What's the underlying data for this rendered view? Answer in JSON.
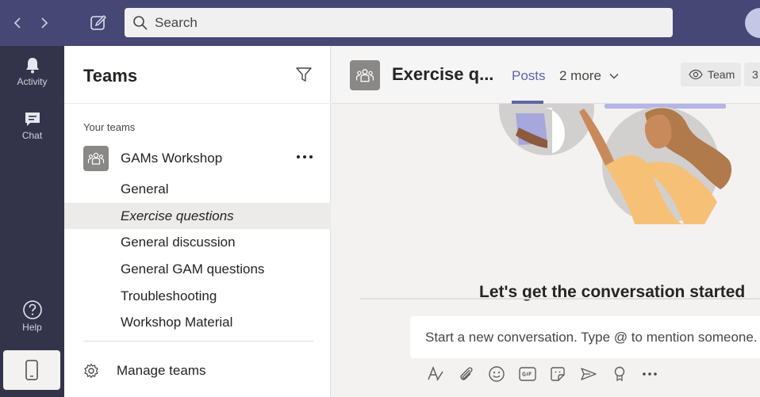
{
  "titlebar": {
    "back_icon": "chevron-left-icon",
    "forward_icon": "chevron-right-icon",
    "compose_icon": "compose-icon",
    "search_placeholder": "Search",
    "search_icon": "search-icon"
  },
  "rail": {
    "items": [
      {
        "label": "Activity",
        "icon": "bell-icon"
      },
      {
        "label": "Chat",
        "icon": "chat-icon"
      },
      {
        "label": "Help",
        "icon": "help-icon"
      }
    ],
    "mobile_icon": "mobile-phone-icon"
  },
  "teams_panel": {
    "title": "Teams",
    "filter_icon": "filter-icon",
    "section_label": "Your teams",
    "team": {
      "name": "GAMs Workshop",
      "more_icon": "more-icon",
      "channels": [
        {
          "name": "General",
          "active": false
        },
        {
          "name": "Exercise questions",
          "active": true
        },
        {
          "name": "General discussion",
          "active": false
        },
        {
          "name": "General GAM questions",
          "active": false
        },
        {
          "name": "Troubleshooting",
          "active": false
        },
        {
          "name": "Workshop Material",
          "active": false
        }
      ]
    },
    "manage_label": "Manage teams",
    "manage_icon": "gear-icon"
  },
  "channel_header": {
    "title": "Exercise q...",
    "tabs": [
      {
        "label": "Posts",
        "active": true
      },
      {
        "label": "2 more",
        "active": false
      }
    ],
    "team_button": "Team",
    "count_button": "3"
  },
  "main": {
    "headline": "Let's get the conversation started",
    "composer_placeholder": "Start a new conversation. Type @ to mention someone.",
    "toolbar_icons": [
      "format-icon",
      "attach-icon",
      "emoji-icon",
      "gif-icon",
      "sticker-icon",
      "meet-now-icon",
      "praise-icon",
      "more-options-icon"
    ]
  },
  "colors": {
    "titlebar": "#464775",
    "rail": "#33344a",
    "accent": "#6264a7",
    "panel": "#ffffff",
    "selected_channel": "#edebe9"
  }
}
